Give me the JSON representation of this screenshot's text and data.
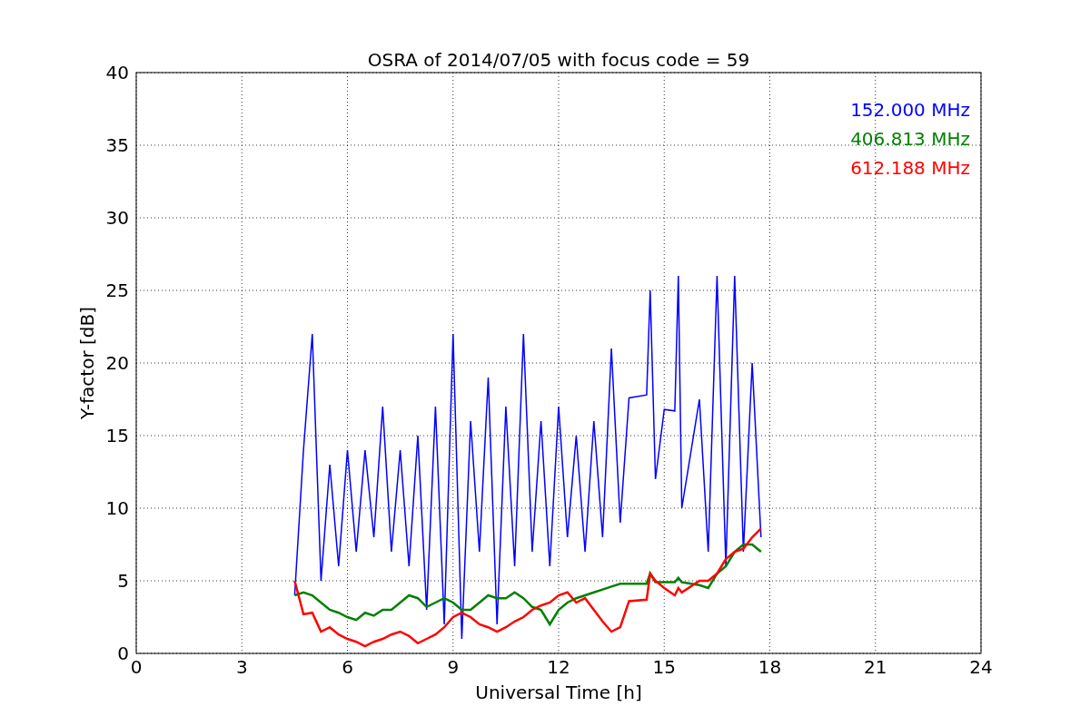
{
  "chart_data": {
    "type": "line",
    "title": "OSRA of 2014/07/05 with focus code = 59",
    "xlabel": "Universal Time [h]",
    "ylabel": "Y-factor [dB]",
    "xlim": [
      0,
      24
    ],
    "ylim": [
      0,
      40
    ],
    "xticks": [
      0,
      3,
      6,
      9,
      12,
      15,
      18,
      21,
      24
    ],
    "yticks": [
      0,
      5,
      10,
      15,
      20,
      25,
      30,
      35,
      40
    ],
    "grid": true,
    "x": [
      4.5,
      4.75,
      5,
      5.25,
      5.5,
      5.75,
      6,
      6.25,
      6.5,
      6.75,
      7,
      7.25,
      7.5,
      7.75,
      8,
      8.25,
      8.5,
      8.75,
      9,
      9.25,
      9.5,
      9.75,
      10,
      10.25,
      10.5,
      10.75,
      11,
      11.25,
      11.5,
      11.75,
      12,
      12.25,
      12.5,
      12.75,
      13,
      13.25,
      13.5,
      13.75,
      14,
      14.5,
      14.6,
      14.75,
      15,
      15.3,
      15.4,
      15.5,
      16,
      16.25,
      16.5,
      16.75,
      17,
      17.25,
      17.5,
      17.75
    ],
    "series": [
      {
        "name": "152.000 MHz",
        "color": "#0000ff",
        "values": [
          4,
          14,
          22,
          5,
          13,
          6,
          14,
          7,
          14,
          8,
          17,
          7,
          14,
          6,
          15,
          3,
          17,
          2,
          22,
          1,
          16,
          7,
          19,
          2,
          17,
          6,
          22,
          7,
          16,
          6,
          17,
          8,
          15,
          7,
          16,
          8,
          21,
          9,
          17.6,
          17.8,
          25,
          12,
          16.8,
          16.7,
          26,
          10,
          17.5,
          7,
          26,
          6,
          26,
          7,
          20,
          8
        ]
      },
      {
        "name": "406.813 MHz",
        "color": "#008000",
        "values": [
          4,
          4.2,
          4,
          3.5,
          3,
          2.8,
          2.5,
          2.3,
          2.8,
          2.6,
          3,
          3,
          3.5,
          4,
          3.8,
          3.2,
          3.5,
          3.8,
          3.5,
          3,
          3,
          3.5,
          4,
          3.8,
          3.8,
          4.2,
          3.8,
          3.2,
          3,
          2,
          3,
          3.5,
          3.8,
          4,
          4.2,
          4.4,
          4.6,
          4.8,
          4.8,
          4.8,
          5.5,
          4.9,
          4.9,
          4.9,
          5.2,
          4.9,
          4.7,
          4.5,
          5.5,
          6,
          7,
          7.5,
          7.5,
          7
        ]
      },
      {
        "name": "612.188 MHz",
        "color": "#ff0000",
        "values": [
          5,
          2.7,
          2.8,
          1.5,
          1.8,
          1.3,
          1,
          0.8,
          0.5,
          0.8,
          1,
          1.3,
          1.5,
          1.2,
          0.7,
          1,
          1.3,
          1.8,
          2.5,
          2.8,
          2.5,
          2,
          1.8,
          1.5,
          1.8,
          2.2,
          2.5,
          3,
          3.3,
          3.5,
          4,
          4.2,
          3.5,
          3.8,
          3,
          2.2,
          1.5,
          1.8,
          3.6,
          3.7,
          5.5,
          5,
          4.5,
          4,
          4.5,
          4.2,
          5,
          5,
          5.5,
          6.5,
          7,
          7.2,
          8,
          8.6
        ]
      }
    ]
  }
}
